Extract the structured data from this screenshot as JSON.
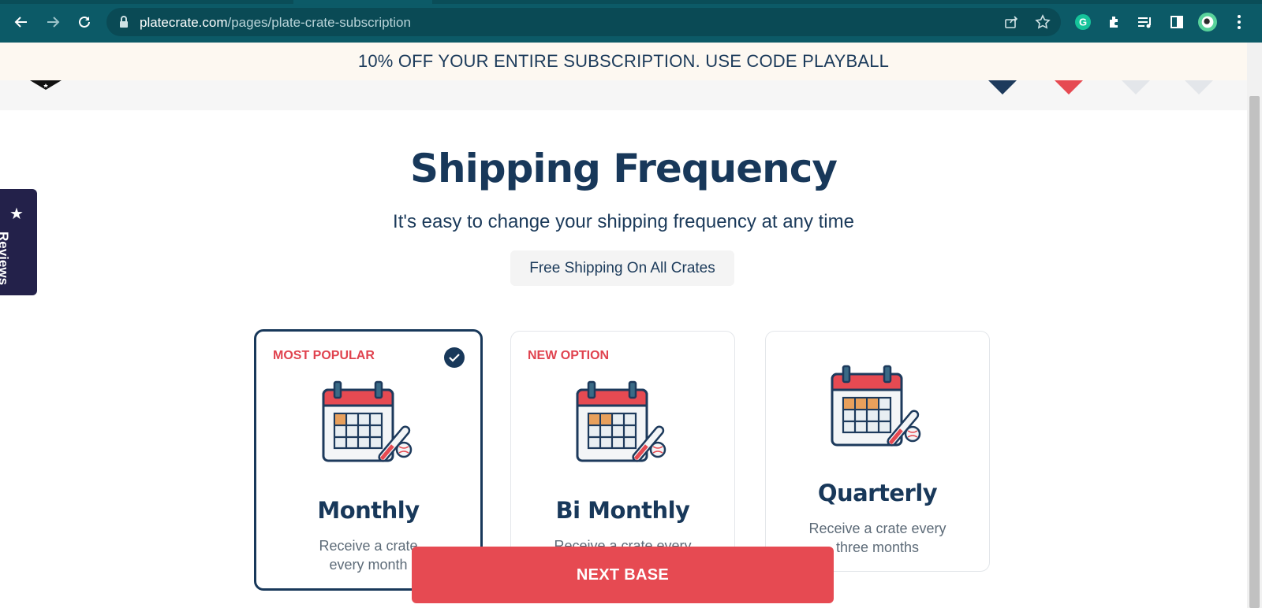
{
  "browser": {
    "url_host": "platecrate.com",
    "url_path": "/pages/plate-crate-subscription",
    "icons": [
      "back-icon",
      "forward-icon",
      "reload-icon",
      "lock-icon",
      "share-icon",
      "star-icon",
      "grammarly-icon",
      "extensions-icon",
      "media-icon",
      "side-panel-icon",
      "profile-icon",
      "menu-icon"
    ]
  },
  "announcement": {
    "text": "10% OFF YOUR ENTIRE SUBSCRIPTION. USE CODE PLAYBALL"
  },
  "page": {
    "title": "Shipping Frequency",
    "subtitle": "It's easy to change your shipping frequency at any time",
    "free_shipping": "Free Shipping On All Crates"
  },
  "plans": [
    {
      "badge": "MOST POPULAR",
      "title": "Monthly",
      "description": "Receive a crate every month",
      "selected": true,
      "highlighted_days": 1
    },
    {
      "badge": "NEW OPTION",
      "title": "Bi Monthly",
      "description": "Receive a crate every other month",
      "selected": false,
      "highlighted_days": 2
    },
    {
      "badge": "",
      "title": "Quarterly",
      "description": "Receive a crate every three months",
      "selected": false,
      "highlighted_days": 3
    }
  ],
  "reviews_tab": {
    "label": "Reviews"
  },
  "next_button": {
    "label": "NEXT BASE"
  },
  "colors": {
    "chrome": "#0c5a67",
    "navy": "#18385a",
    "accent_red": "#e64a52",
    "badge_red": "#e0434f",
    "calendar_orange": "#e8a05c",
    "reviews_bg": "#23214a"
  }
}
